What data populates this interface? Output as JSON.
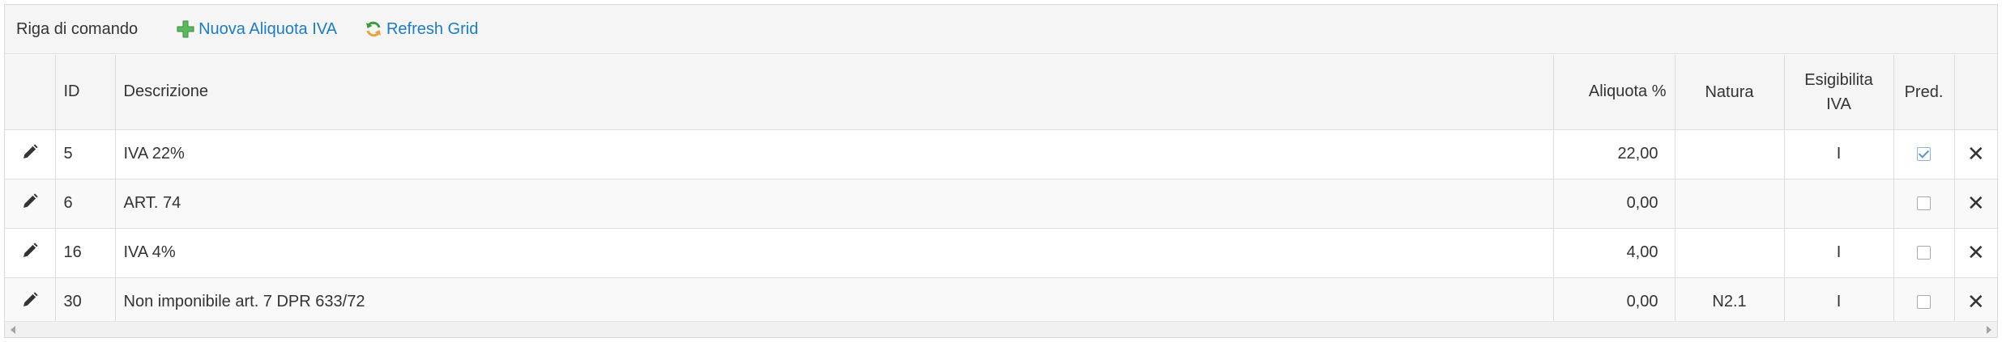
{
  "command_bar": {
    "title": "Riga di comando",
    "add_label": "Nuova Aliquota IVA",
    "refresh_label": "Refresh Grid"
  },
  "columns": {
    "id": "ID",
    "descrizione": "Descrizione",
    "aliquota": "Aliquota %",
    "natura": "Natura",
    "esigibilita": "Esigibilita IVA",
    "pred": "Pred."
  },
  "rows": [
    {
      "id": "5",
      "descrizione": "IVA 22%",
      "aliquota": "22,00",
      "natura": "",
      "esigibilita": "I",
      "pred": true
    },
    {
      "id": "6",
      "descrizione": "ART. 74",
      "aliquota": "0,00",
      "natura": "",
      "esigibilita": "",
      "pred": false
    },
    {
      "id": "16",
      "descrizione": "IVA 4%",
      "aliquota": "4,00",
      "natura": "",
      "esigibilita": "I",
      "pred": false
    },
    {
      "id": "30",
      "descrizione": "Non imponibile art. 7 DPR 633/72",
      "aliquota": "0,00",
      "natura": "N2.1",
      "esigibilita": "I",
      "pred": false
    }
  ],
  "icons": {
    "edit": "pencil-icon",
    "delete": "close-icon",
    "add": "plus-icon",
    "refresh": "refresh-icon"
  },
  "colors": {
    "link": "#1a7cc6",
    "add_icon": "#5cb85c",
    "refresh_icon": "#3c9a3c"
  }
}
